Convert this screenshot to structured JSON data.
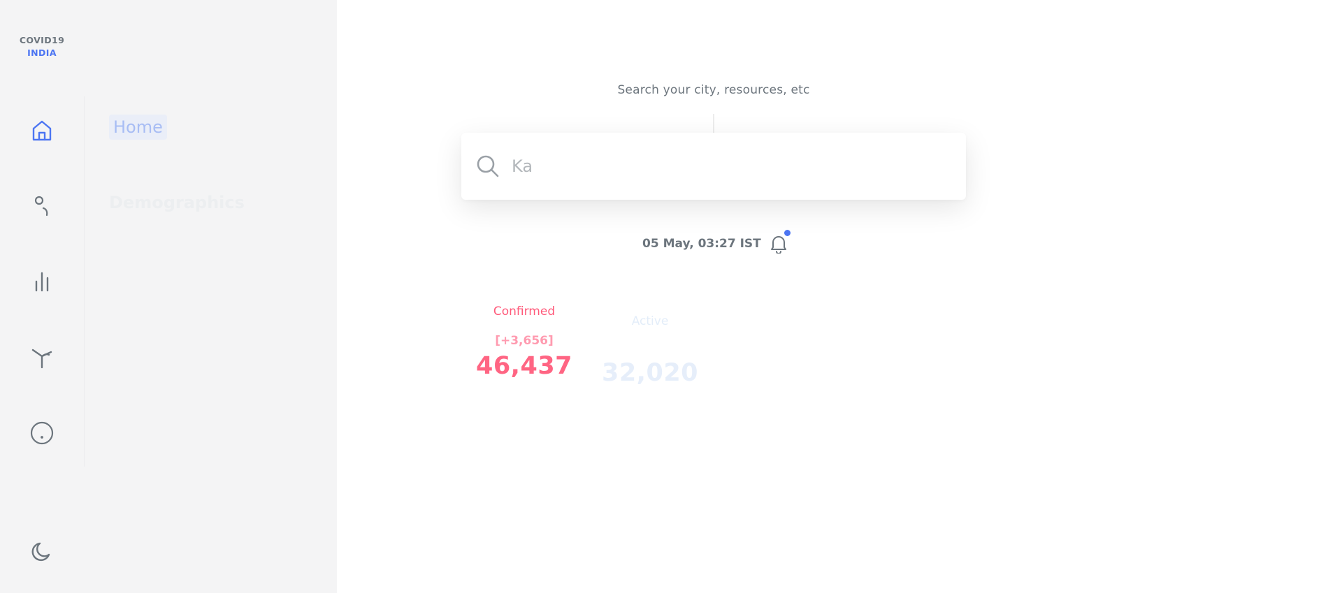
{
  "logo": {
    "line1": "COVID19",
    "line2": "INDIA"
  },
  "nav": {
    "items": [
      {
        "id": "home",
        "label": "Home",
        "icon": "home-icon",
        "active": true
      },
      {
        "id": "demographics",
        "label": "Demographics",
        "icon": "user-icon",
        "active": false
      },
      {
        "id": "charts",
        "icon": "bar-chart-icon"
      },
      {
        "id": "essentials",
        "icon": "tree-icon"
      },
      {
        "id": "about",
        "icon": "info-circle-icon"
      }
    ],
    "theme_toggle_icon": "moon-icon"
  },
  "search": {
    "hint": "Search your city, resources, etc",
    "value": "Ka",
    "icon": "search-icon"
  },
  "update": {
    "timestamp": "05 May, 03:27 IST",
    "icon": "bell-icon"
  },
  "stats": {
    "confirmed": {
      "label": "Confirmed",
      "delta": "[+3,656]",
      "value": "46,437"
    },
    "active": {
      "label": "Active",
      "value": "32,020"
    }
  },
  "colors": {
    "sidebar_bg": "#f4f4f5",
    "accent_blue": "#4c75f2",
    "confirmed_red": "#ff6583",
    "muted_gray": "#6c757d"
  }
}
